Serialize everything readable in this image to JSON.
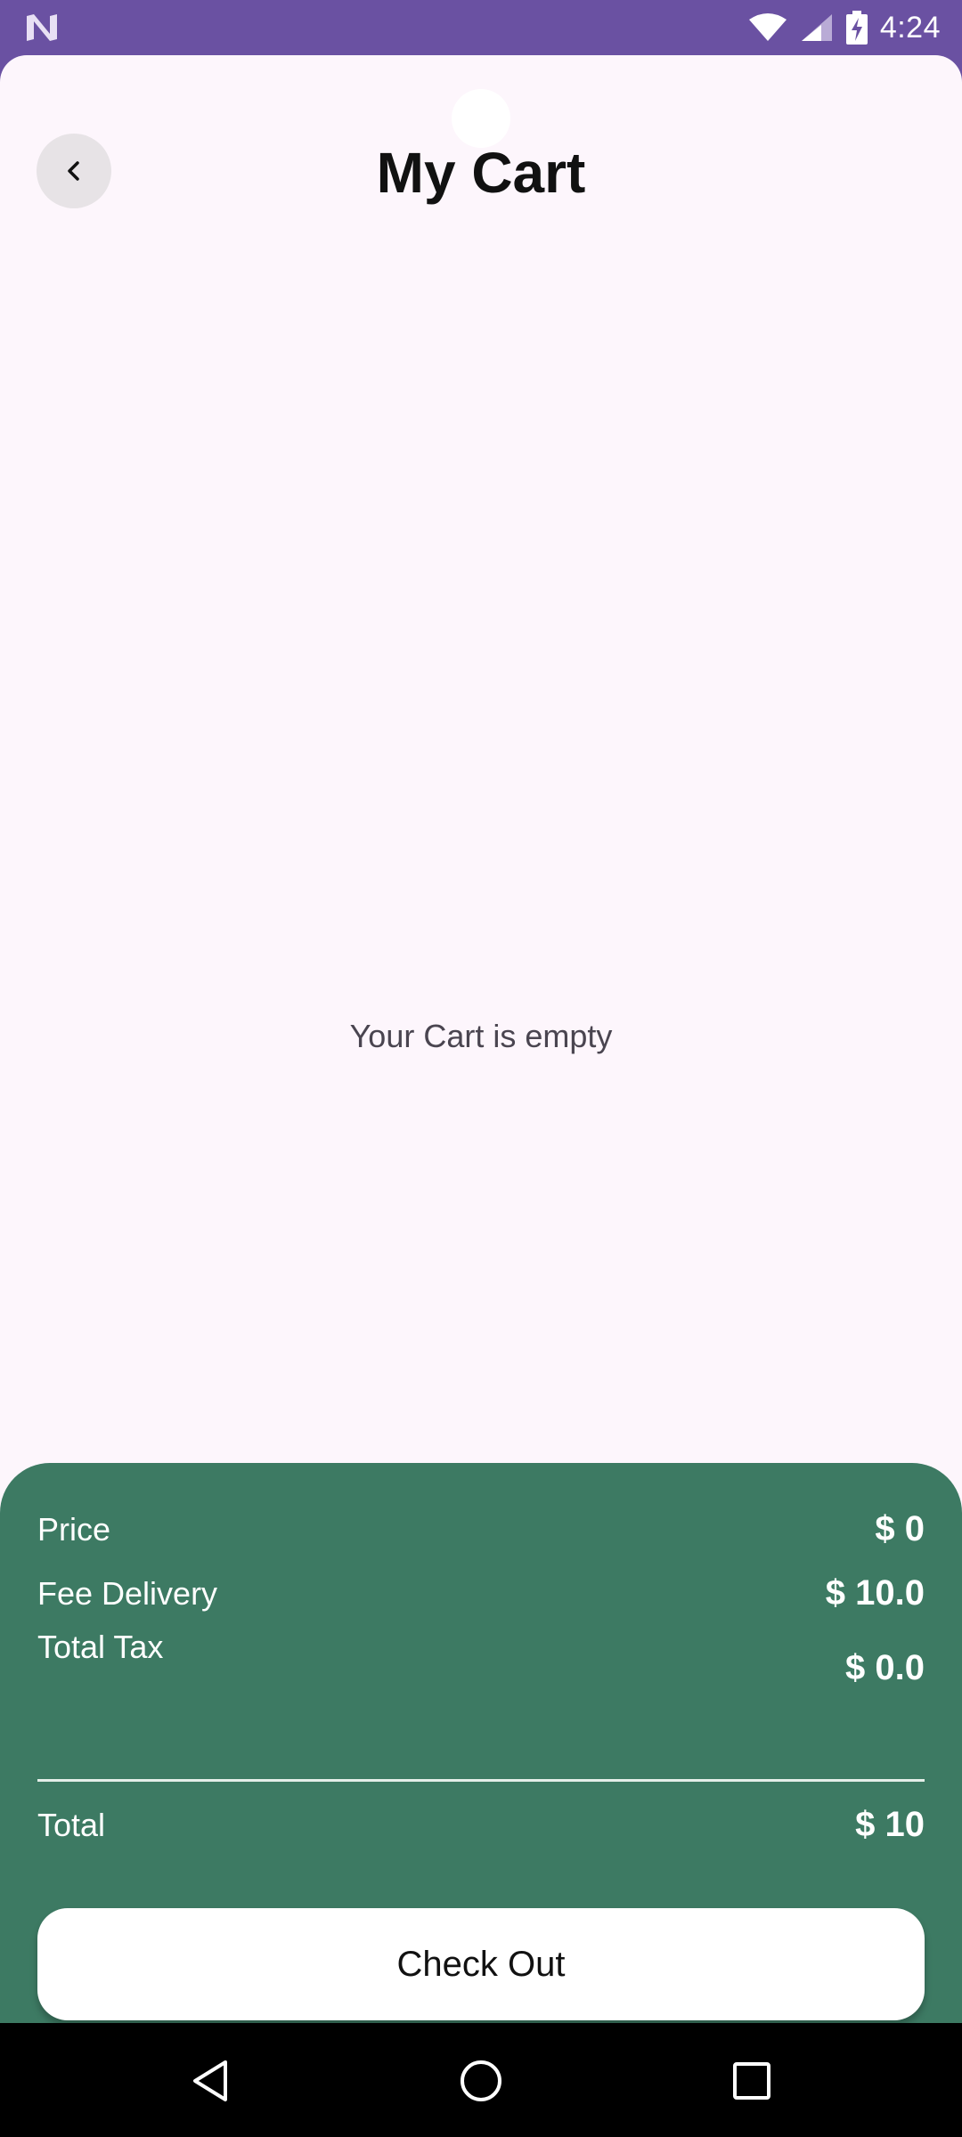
{
  "status_bar": {
    "time": "4:24",
    "icons": [
      "notification-n-icon",
      "wifi-icon",
      "cellular-signal-icon",
      "battery-charging-icon"
    ]
  },
  "header": {
    "back_icon": "chevron-left-icon",
    "title": "My Cart"
  },
  "cart": {
    "empty_message": "Your Cart is empty"
  },
  "summary": {
    "rows": [
      {
        "label": "Price",
        "value": "$ 0"
      },
      {
        "label": "Fee Delivery",
        "value": "$ 10.0"
      },
      {
        "label": "Total Tax",
        "value": "$ 0.0"
      }
    ],
    "total": {
      "label": "Total",
      "value": "$ 10"
    },
    "checkout_label": "Check Out"
  },
  "nav_bar": {
    "icons": [
      "back-triangle-icon",
      "home-circle-icon",
      "recents-square-icon"
    ]
  },
  "colors": {
    "status_bar": "#6a51a2",
    "background": "#fdf6fc",
    "summary_panel": "#3d7a63",
    "button": "#ffffff"
  }
}
